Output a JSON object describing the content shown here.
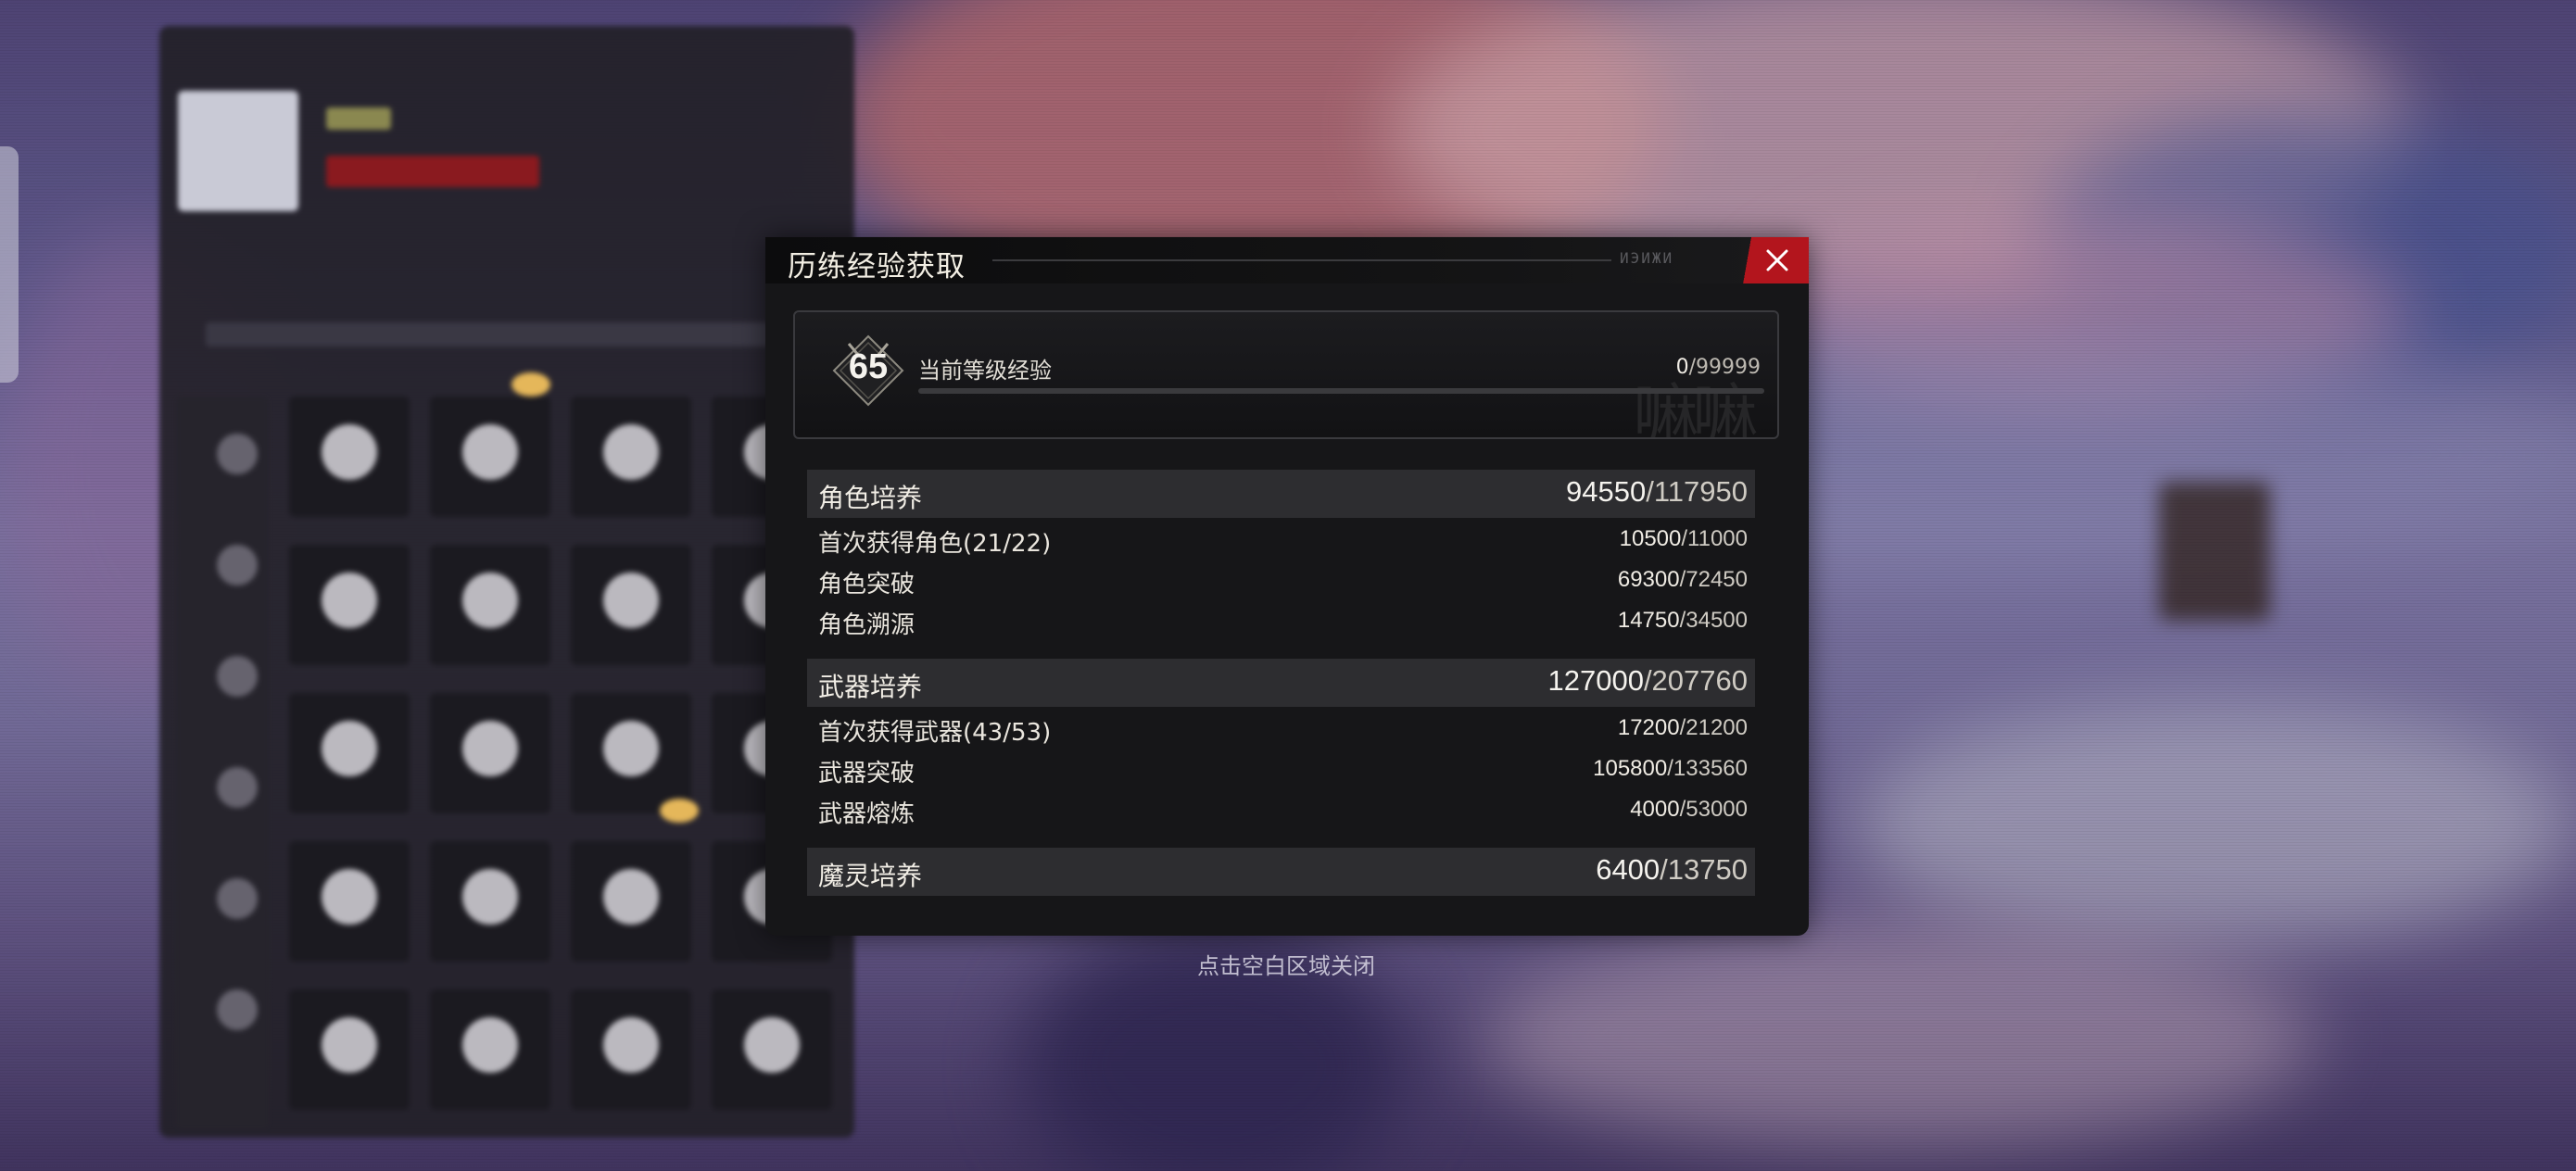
{
  "dialog": {
    "title": "历练经验获取",
    "header_deco": "ИЭИЖИ",
    "close_icon": "close-x-icon",
    "level": {
      "value": "65",
      "label": "当前等级经验",
      "current": "0",
      "max": "/99999",
      "progress_fraction": 0.0
    },
    "sections": [
      {
        "label": "角色培养",
        "current": "94550",
        "max": "/117950",
        "rows": [
          {
            "label": "首次获得角色(21/22)",
            "current": "10500",
            "max": "/11000"
          },
          {
            "label": "角色突破",
            "current": "69300",
            "max": "/72450"
          },
          {
            "label": "角色溯源",
            "current": "14750",
            "max": "/34500"
          }
        ]
      },
      {
        "label": "武器培养",
        "current": "127000",
        "max": "/207760",
        "rows": [
          {
            "label": "首次获得武器(43/53)",
            "current": "17200",
            "max": "/21200"
          },
          {
            "label": "武器突破",
            "current": "105800",
            "max": "/133560"
          },
          {
            "label": "武器熔炼",
            "current": "4000",
            "max": "/53000"
          }
        ]
      },
      {
        "label": "魔灵培养",
        "current": "6400",
        "max": "/13750",
        "rows": []
      }
    ]
  },
  "hint": "点击空白区域关闭",
  "colors": {
    "close_button": "#b3151d",
    "section_bg": "#2d2d30",
    "dialog_bg": "#161618",
    "exp_bar_fill": "#d8c58c"
  }
}
